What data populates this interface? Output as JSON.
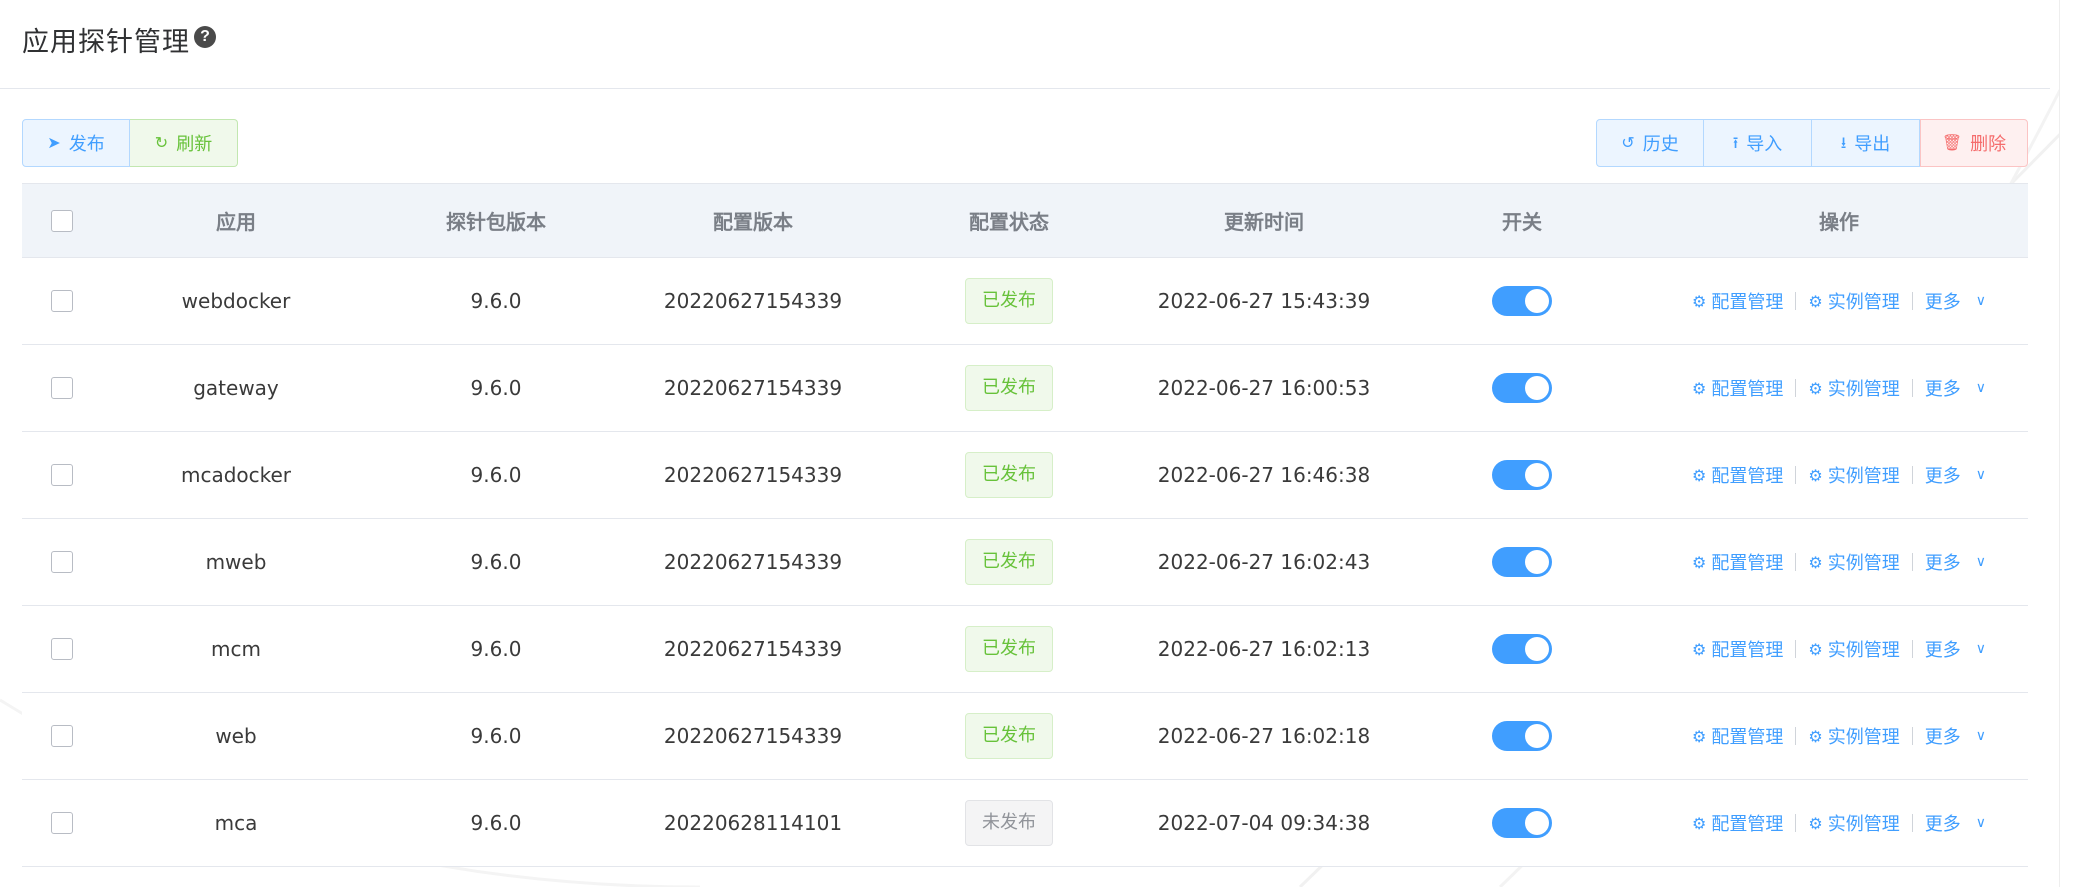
{
  "page": {
    "title": "应用探针管理",
    "help_icon": "?"
  },
  "toolbar": {
    "publish_label": "发布",
    "refresh_label": "刷新",
    "history_label": "历史",
    "import_label": "导入",
    "export_label": "导出",
    "delete_label": "删除"
  },
  "table": {
    "headers": {
      "app": "应用",
      "agent_version": "探针包版本",
      "config_version": "配置版本",
      "config_status": "配置状态",
      "updated_at": "更新时间",
      "switch": "开关",
      "actions": "操作"
    },
    "action_labels": {
      "config": "配置管理",
      "instances": "实例管理",
      "more": "更多"
    },
    "rows": [
      {
        "app": "webdocker",
        "agent_version": "9.6.0",
        "config_version": "20220627154339",
        "status": "已发布",
        "published": true,
        "updated_at": "2022-06-27 15:43:39",
        "switch_on": true
      },
      {
        "app": "gateway",
        "agent_version": "9.6.0",
        "config_version": "20220627154339",
        "status": "已发布",
        "published": true,
        "updated_at": "2022-06-27 16:00:53",
        "switch_on": true
      },
      {
        "app": "mcadocker",
        "agent_version": "9.6.0",
        "config_version": "20220627154339",
        "status": "已发布",
        "published": true,
        "updated_at": "2022-06-27 16:46:38",
        "switch_on": true
      },
      {
        "app": "mweb",
        "agent_version": "9.6.0",
        "config_version": "20220627154339",
        "status": "已发布",
        "published": true,
        "updated_at": "2022-06-27 16:02:43",
        "switch_on": true
      },
      {
        "app": "mcm",
        "agent_version": "9.6.0",
        "config_version": "20220627154339",
        "status": "已发布",
        "published": true,
        "updated_at": "2022-06-27 16:02:13",
        "switch_on": true
      },
      {
        "app": "web",
        "agent_version": "9.6.0",
        "config_version": "20220627154339",
        "status": "已发布",
        "published": true,
        "updated_at": "2022-06-27 16:02:18",
        "switch_on": true
      },
      {
        "app": "mca",
        "agent_version": "9.6.0",
        "config_version": "20220628114101",
        "status": "未发布",
        "published": false,
        "updated_at": "2022-07-04 09:34:38",
        "switch_on": true
      }
    ]
  },
  "colors": {
    "primary": "#409eff",
    "success": "#67c23a",
    "danger": "#f56c6c",
    "header_bg": "#f0f4f9"
  }
}
